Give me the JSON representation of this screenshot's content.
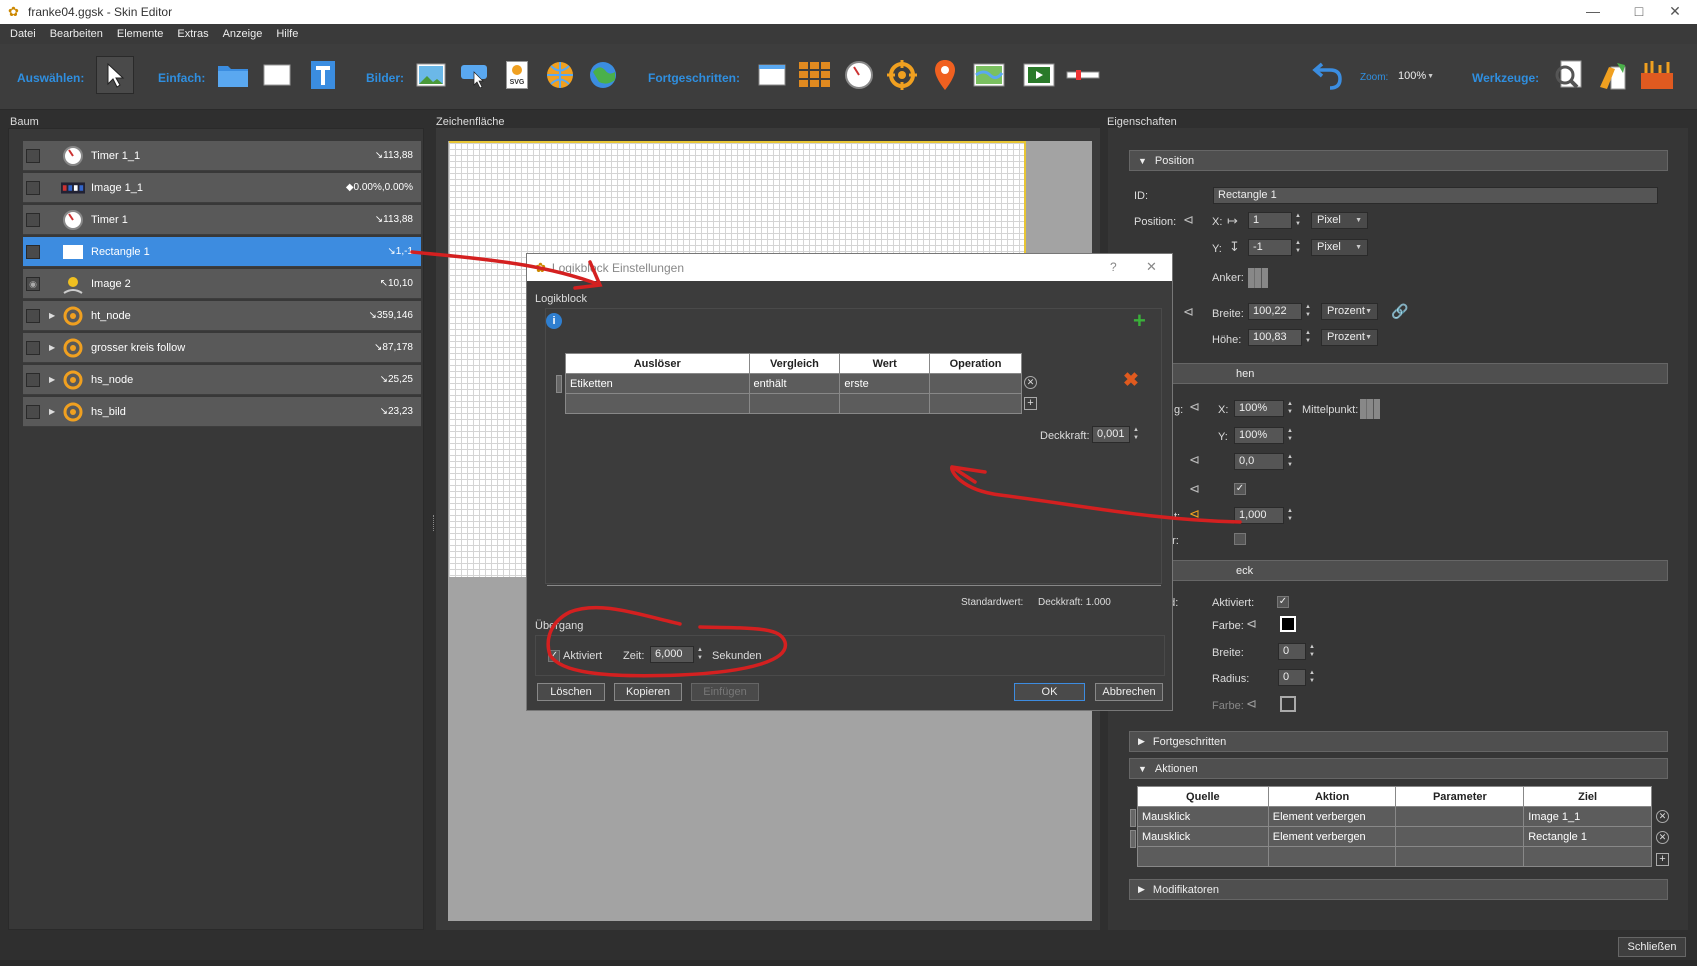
{
  "window": {
    "title": "franke04.ggsk - Skin Editor",
    "minimize": "—",
    "maximize": "□",
    "close": "✕"
  },
  "menu": [
    "Datei",
    "Bearbeiten",
    "Elemente",
    "Extras",
    "Anzeige",
    "Hilfe"
  ],
  "toolbar": {
    "select_label": "Auswählen:",
    "simple_label": "Einfach:",
    "images_label": "Bilder:",
    "advanced_label": "Fortgeschritten:",
    "zoom_label": "Zoom:",
    "zoom_value": "100%",
    "tools_label": "Werkzeuge:",
    "svg_text": "SVG"
  },
  "tree": {
    "title": "Baum",
    "rows": [
      {
        "name": "Timer 1_1",
        "value": "↘113,88",
        "expand": ""
      },
      {
        "name": "Image 1_1",
        "value": "◆0.00%,0.00%",
        "expand": ""
      },
      {
        "name": "Timer 1",
        "value": "↘113,88",
        "expand": ""
      },
      {
        "name": "Rectangle 1",
        "value": "↘1,-1",
        "expand": ""
      },
      {
        "name": "Image 2",
        "value": "↖10,10",
        "expand": ""
      },
      {
        "name": "ht_node",
        "value": "↘359,146",
        "expand": "▶"
      },
      {
        "name": "grosser kreis follow",
        "value": "↘87,178",
        "expand": "▶"
      },
      {
        "name": "hs_node",
        "value": "↘25,25",
        "expand": "▶"
      },
      {
        "name": "hs_bild",
        "value": "↘23,23",
        "expand": "▶"
      }
    ]
  },
  "canvas": {
    "title": "Zeichenfläche"
  },
  "properties": {
    "title": "Eigenschaften",
    "position_section": "Position",
    "id_label": "ID:",
    "id_value": "Rectangle 1",
    "position_label": "Position:",
    "x_label": "X:",
    "x_value": "1",
    "x_unit": "Pixel",
    "y_label": "Y:",
    "y_value": "-1",
    "y_unit": "Pixel",
    "anchor_label": "Anker:",
    "width_label": "Breite:",
    "width_value": "100,22",
    "width_unit": "Prozent",
    "height_label": "Höhe:",
    "height_value": "100,83",
    "height_unit": "Prozent",
    "appearance_section": "hen",
    "scale_label": "g:",
    "sx_label": "X:",
    "sx_value": "100%",
    "center_label": "Mittelpunkt:",
    "sy_label": "Y:",
    "sy_value": "100%",
    "angle_value": "0,0",
    "opacity_label": "t:",
    "opacity_value": "1,000",
    "cursor_label": "er:",
    "rect_section": "eck",
    "bg_label": "nd:",
    "enabled_label": "Aktiviert:",
    "color_label": "Farbe:",
    "border_width_label": "Breite:",
    "border_width_value": "0",
    "radius_label": "Radius:",
    "radius_value": "0",
    "color2_label": "Farbe:",
    "advanced_section": "Fortgeschritten",
    "actions_section": "Aktionen",
    "actions_headers": [
      "Quelle",
      "Aktion",
      "Parameter",
      "Ziel"
    ],
    "actions_rows": [
      [
        "Mausklick",
        "Element verbergen",
        "",
        "Image 1_1"
      ],
      [
        "Mausklick",
        "Element verbergen",
        "",
        "Rectangle 1"
      ]
    ],
    "modifiers_section": "Modifikatoren"
  },
  "dialog": {
    "title": "Logikblock Einstellungen",
    "help": "?",
    "close": "✕",
    "group_label": "Logikblock",
    "table_headers": [
      "Auslöser",
      "Vergleich",
      "Wert",
      "Operation"
    ],
    "table_rows": [
      [
        "Etiketten",
        "enthält",
        "erste",
        ""
      ]
    ],
    "opacity_label": "Deckkraft:",
    "opacity_value": "0,001",
    "default_label": "Standardwert:",
    "default_value": "Deckkraft: 1.000",
    "transition_label": "Übergang",
    "enabled_label": "Aktiviert",
    "time_label": "Zeit:",
    "time_value": "6,000",
    "seconds_label": "Sekunden",
    "delete_btn": "Löschen",
    "copy_btn": "Kopieren",
    "paste_btn": "Einfügen",
    "ok_btn": "OK",
    "cancel_btn": "Abbrechen"
  },
  "close_button": "Schließen",
  "colors": {
    "accent": "#2f8fe0",
    "selection": "#3d8ce0",
    "annotation": "#d42020",
    "add": "#3ab03a",
    "remove": "#e05a1e"
  }
}
